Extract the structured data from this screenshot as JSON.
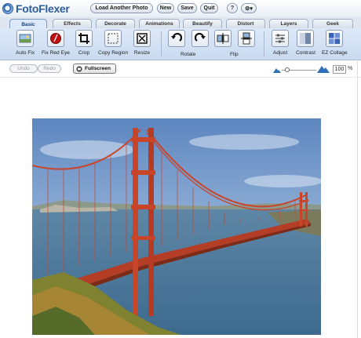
{
  "app": {
    "name": "FotoFlexer"
  },
  "header": {
    "load_label": "Load Another Photo",
    "new_label": "New",
    "save_label": "Save",
    "quit_label": "Quit",
    "help_label": "?",
    "settings_label": "⚙▾"
  },
  "tabs": [
    "Basic",
    "Effects",
    "Decorate",
    "Animations",
    "Beautify",
    "Distort",
    "Layers",
    "Geek"
  ],
  "active_tab": "Basic",
  "tools": {
    "auto_fix": "Auto Fix",
    "fix_red_eye": "Fix Red Eye",
    "crop": "Crop",
    "copy_region": "Copy Region",
    "resize": "Resize",
    "rotate": "Rotate",
    "flip": "Flip",
    "adjust": "Adjust",
    "contrast": "Contrast",
    "ez_collage": "EZ Collage"
  },
  "history": {
    "undo": "Undo",
    "redo": "Redo"
  },
  "fullscreen_label": "Fullscreen",
  "zoom": {
    "value": "100",
    "unit": "%"
  },
  "colors": {
    "brand": "#2d5e9c",
    "sky": "#7fa3d0",
    "bridge": "#c8452a",
    "water": "#3f6f94"
  }
}
